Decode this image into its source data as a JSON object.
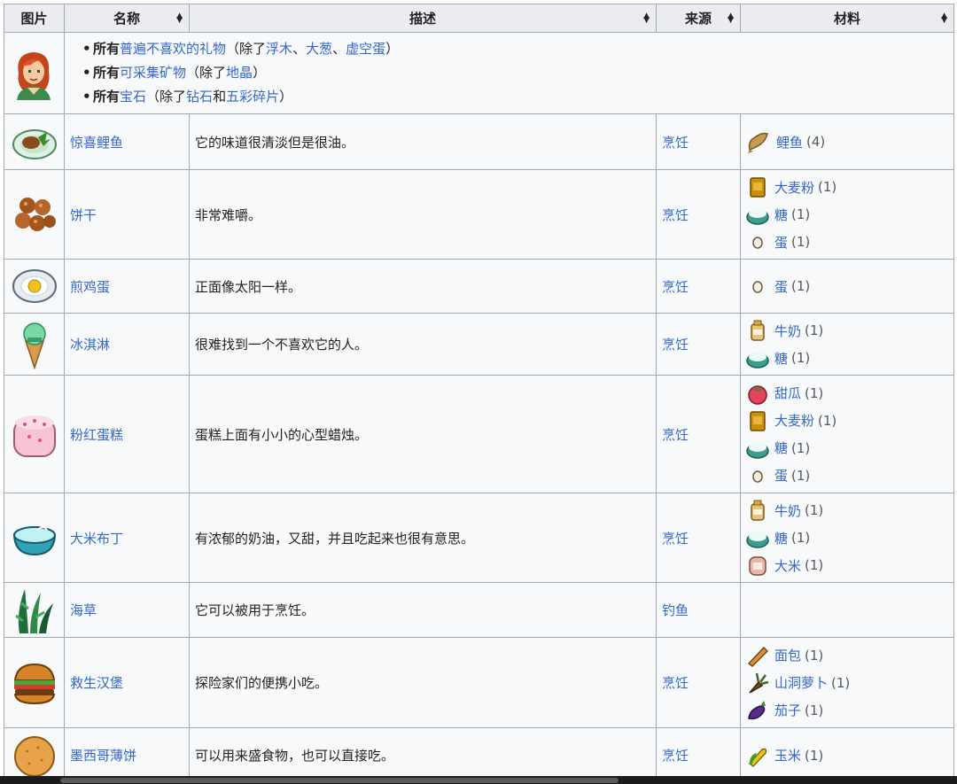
{
  "headers": [
    "图片",
    "名称",
    "描述",
    "来源",
    "材料"
  ],
  "loved_all": [
    {
      "prefix": "所有",
      "link": "普遍不喜欢的礼物",
      "open": "（除了",
      "items": [
        "浮木",
        "大葱",
        "虚空蛋"
      ],
      "close": "）"
    },
    {
      "prefix": "所有",
      "link": "可采集矿物",
      "open": "（除了",
      "items": [
        "地晶"
      ],
      "close": "）"
    },
    {
      "prefix": "所有",
      "link": "宝石",
      "open": "（除了",
      "items": [
        "钻石",
        "五彩碎片"
      ],
      "close": "）"
    }
  ],
  "sep_dun": "、",
  "sep_he": "和",
  "rows": [
    {
      "name": "惊喜鲤鱼",
      "icon": "fish-dish-icon",
      "desc": "它的味道很清淡但是很油。",
      "source": "烹饪",
      "ingredients": [
        {
          "icon": "carp-icon",
          "name": "鲤鱼",
          "count": "(4)"
        }
      ]
    },
    {
      "name": "饼干",
      "icon": "cookies-icon",
      "desc": "非常难嚼。",
      "source": "烹饪",
      "ingredients": [
        {
          "icon": "wheat-flour-icon",
          "name": "大麦粉",
          "count": "(1)"
        },
        {
          "icon": "sugar-icon",
          "name": "糖",
          "count": "(1)"
        },
        {
          "icon": "egg-icon",
          "name": "蛋",
          "count": "(1)"
        }
      ]
    },
    {
      "name": "煎鸡蛋",
      "icon": "fried-egg-icon",
      "desc": "正面像太阳一样。",
      "source": "烹饪",
      "ingredients": [
        {
          "icon": "egg-icon",
          "name": "蛋",
          "count": "(1)"
        }
      ]
    },
    {
      "name": "冰淇淋",
      "icon": "ice-cream-icon",
      "desc": "很难找到一个不喜欢它的人。",
      "source": "烹饪",
      "ingredients": [
        {
          "icon": "milk-icon",
          "name": "牛奶",
          "count": "(1)"
        },
        {
          "icon": "sugar-icon",
          "name": "糖",
          "count": "(1)"
        }
      ]
    },
    {
      "name": "粉红蛋糕",
      "icon": "pink-cake-icon",
      "desc": "蛋糕上面有小小的心型蜡烛。",
      "source": "烹饪",
      "ingredients": [
        {
          "icon": "melon-icon",
          "name": "甜瓜",
          "count": "(1)"
        },
        {
          "icon": "wheat-flour-icon",
          "name": "大麦粉",
          "count": "(1)"
        },
        {
          "icon": "sugar-icon",
          "name": "糖",
          "count": "(1)"
        },
        {
          "icon": "egg-icon",
          "name": "蛋",
          "count": "(1)"
        }
      ]
    },
    {
      "name": "大米布丁",
      "icon": "rice-pudding-icon",
      "desc": "有浓郁的奶油，又甜，并且吃起来也很有意思。",
      "source": "烹饪",
      "ingredients": [
        {
          "icon": "milk-icon",
          "name": "牛奶",
          "count": "(1)"
        },
        {
          "icon": "sugar-icon",
          "name": "糖",
          "count": "(1)"
        },
        {
          "icon": "rice-icon",
          "name": "大米",
          "count": "(1)"
        }
      ]
    },
    {
      "name": "海草",
      "icon": "seaweed-icon",
      "desc": "它可以被用于烹饪。",
      "source": "钓鱼",
      "ingredients": []
    },
    {
      "name": "救生汉堡",
      "icon": "burger-icon",
      "desc": "探险家们的便携小吃。",
      "source": "烹饪",
      "ingredients": [
        {
          "icon": "bread-icon",
          "name": "面包",
          "count": "(1)"
        },
        {
          "icon": "cave-carrot-icon",
          "name": "山洞萝卜",
          "count": "(1)"
        },
        {
          "icon": "eggplant-icon",
          "name": "茄子",
          "count": "(1)"
        }
      ]
    },
    {
      "name": "墨西哥薄饼",
      "icon": "tortilla-icon",
      "desc": "可以用来盛食物，也可以直接吃。",
      "source": "烹饪",
      "ingredients": [
        {
          "icon": "corn-icon",
          "name": "玉米",
          "count": "(1)"
        }
      ]
    }
  ]
}
